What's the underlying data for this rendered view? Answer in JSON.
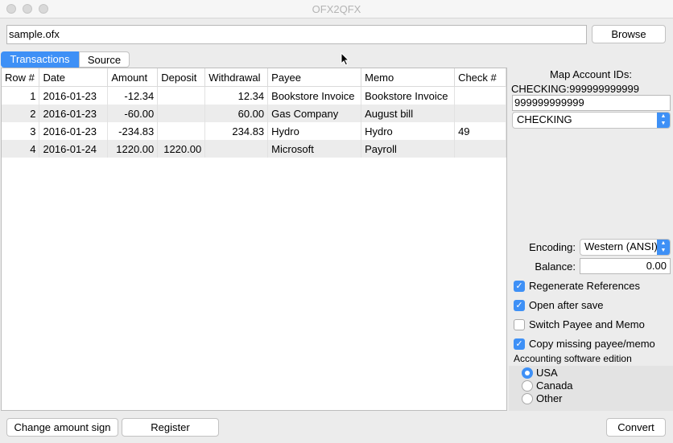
{
  "window": {
    "title": "OFX2QFX"
  },
  "file": {
    "path": "sample.ofx",
    "browse_label": "Browse"
  },
  "tabs": [
    {
      "label": "Transactions",
      "active": true
    },
    {
      "label": "Source",
      "active": false
    }
  ],
  "table": {
    "columns": [
      "Row #",
      "Date",
      "Amount",
      "Deposit",
      "Withdrawal",
      "Payee",
      "Memo",
      "Check #"
    ],
    "rows": [
      [
        "1",
        "2016-01-23",
        "-12.34",
        "",
        "12.34",
        "Bookstore Invoice",
        "Bookstore Invoice",
        ""
      ],
      [
        "2",
        "2016-01-23",
        "-60.00",
        "",
        "60.00",
        "Gas Company",
        "August bill",
        ""
      ],
      [
        "3",
        "2016-01-23",
        "-234.83",
        "",
        "234.83",
        "Hydro",
        "Hydro",
        "49"
      ],
      [
        "4",
        "2016-01-24",
        "1220.00",
        "1220.00",
        "",
        "Microsoft",
        "Payroll",
        ""
      ]
    ]
  },
  "side": {
    "map_label": "Map Account IDs:",
    "account_line": "CHECKING:999999999999",
    "account_value": "999999999999",
    "account_type": "CHECKING",
    "encoding_label": "Encoding:",
    "encoding_value": "Western (ANSI)",
    "balance_label": "Balance:",
    "balance_value": "0.00",
    "options": [
      {
        "label": "Regenerate References",
        "checked": true
      },
      {
        "label": "Open after save",
        "checked": true
      },
      {
        "label": "Switch Payee and Memo",
        "checked": false
      },
      {
        "label": "Copy missing payee/memo",
        "checked": true
      }
    ],
    "edition_label": "Accounting software edition",
    "editions": [
      {
        "label": "USA",
        "selected": true
      },
      {
        "label": "Canada",
        "selected": false
      },
      {
        "label": "Other",
        "selected": false
      }
    ]
  },
  "footer": {
    "change_sign_label": "Change amount sign",
    "register_label": "Register",
    "convert_label": "Convert"
  },
  "colors": {
    "accent": "#3e90f6",
    "alt_row": "#ececec"
  }
}
